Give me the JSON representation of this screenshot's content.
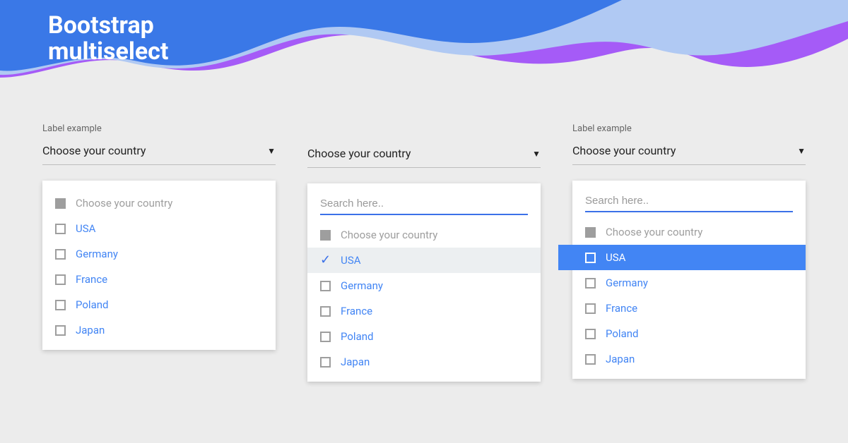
{
  "title_line1": "Bootstrap",
  "title_line2": "multiselect",
  "panels": {
    "p1": {
      "label": "Label example",
      "trigger": "Choose your country",
      "placeholder_option": "Choose your country",
      "options": [
        "USA",
        "Germany",
        "France",
        "Poland",
        "Japan"
      ]
    },
    "p2": {
      "trigger": "Choose your country",
      "search_placeholder": "Search here..",
      "placeholder_option": "Choose your country",
      "options": [
        "USA",
        "Germany",
        "France",
        "Poland",
        "Japan"
      ]
    },
    "p3": {
      "label": "Label example",
      "trigger": "Choose your country",
      "search_placeholder": "Search here..",
      "placeholder_option": "Choose your country",
      "options": [
        "USA",
        "Germany",
        "France",
        "Poland",
        "Japan"
      ]
    }
  }
}
